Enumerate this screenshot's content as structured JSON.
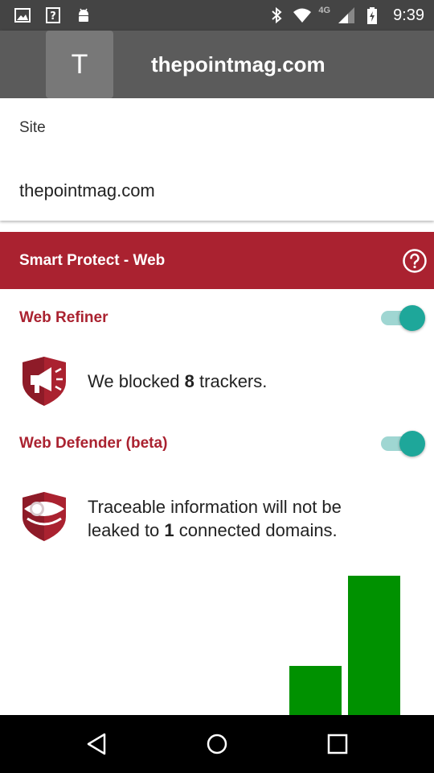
{
  "status_bar": {
    "time": "9:39",
    "network": "4G",
    "icons": [
      "gallery-icon",
      "help-box-icon",
      "android-icon",
      "bluetooth-icon",
      "wifi-icon",
      "signal-icon",
      "battery-charging-icon"
    ]
  },
  "app_bar": {
    "avatar_letter": "T",
    "title": "thepointmag.com"
  },
  "site": {
    "label": "Site",
    "value": "thepointmag.com"
  },
  "section": {
    "title": "Smart Protect - Web",
    "help_icon": "help-circle-icon"
  },
  "web_refiner": {
    "title": "Web Refiner",
    "enabled": true,
    "text_prefix": "We blocked ",
    "count": "8",
    "text_suffix": " trackers.",
    "icon": "megaphone-shield-icon"
  },
  "web_defender": {
    "title": "Web Defender (beta)",
    "enabled": true,
    "line1": "Traceable information will not be",
    "line2_prefix": "leaked to ",
    "count": "1",
    "line2_suffix": " connected domains.",
    "icon": "eye-shield-icon"
  },
  "chart_data": {
    "type": "bar",
    "categories": [
      "",
      ""
    ],
    "values": [
      1,
      8
    ],
    "color": "#009100"
  },
  "colors": {
    "accent": "#aa2230",
    "toggle": "#1ea79a",
    "bar": "#009100"
  },
  "nav_bar": {
    "icons": [
      "back-icon",
      "home-icon",
      "recents-icon"
    ]
  }
}
